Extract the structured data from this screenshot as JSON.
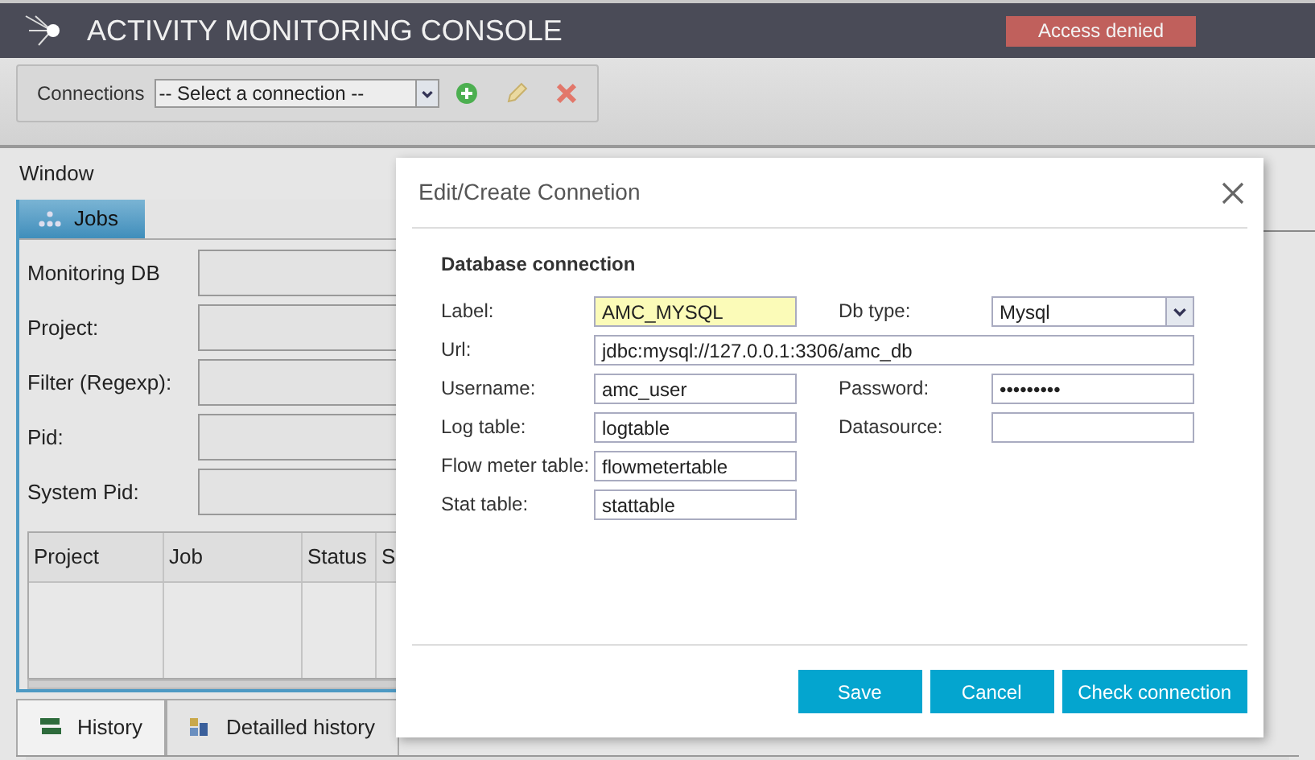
{
  "header": {
    "title": "ACTIVITY MONITORING CONSOLE",
    "alert": "Access denied"
  },
  "toolbar": {
    "label": "Connections",
    "select_value": "-- Select a connection --"
  },
  "menu": {
    "label": "Window"
  },
  "jobs_panel": {
    "tab": "Jobs",
    "fields": [
      {
        "label": "Monitoring DB"
      },
      {
        "label": "Project:"
      },
      {
        "label": "Filter (Regexp):"
      },
      {
        "label": "Pid:"
      },
      {
        "label": "System Pid:"
      }
    ],
    "table": {
      "columns": [
        "Project",
        "Job",
        "Status",
        "S"
      ]
    }
  },
  "bottom_tabs": [
    {
      "label": "History",
      "selected": true
    },
    {
      "label": "Detailled history",
      "selected": false
    }
  ],
  "dialog": {
    "title": "Edit/Create Connetion",
    "section": "Database connection",
    "rows": [
      [
        {
          "label": "Label:",
          "value": "AMC_MYSQL",
          "kind": "highlighted"
        },
        {
          "label": "Db type:",
          "value": "Mysql",
          "kind": "select"
        }
      ],
      [
        {
          "label": "Url:",
          "value": "jdbc:mysql://127.0.0.1:3306/amc_db",
          "kind": "wide"
        }
      ],
      [
        {
          "label": "Username:",
          "value": "amc_user",
          "kind": "text"
        },
        {
          "label": "Password:",
          "value": "•••••••••",
          "kind": "text"
        }
      ],
      [
        {
          "label": "Log table:",
          "value": "logtable",
          "kind": "text"
        },
        {
          "label": "Datasource:",
          "kind": "text"
        }
      ],
      [
        {
          "label": "Flow meter table:",
          "value": "flowmetertable",
          "kind": "text"
        }
      ],
      [
        {
          "label": "Stat table:",
          "value": "stattable",
          "kind": "text"
        }
      ]
    ],
    "buttons": [
      "Save",
      "Cancel",
      "Check connection"
    ]
  }
}
